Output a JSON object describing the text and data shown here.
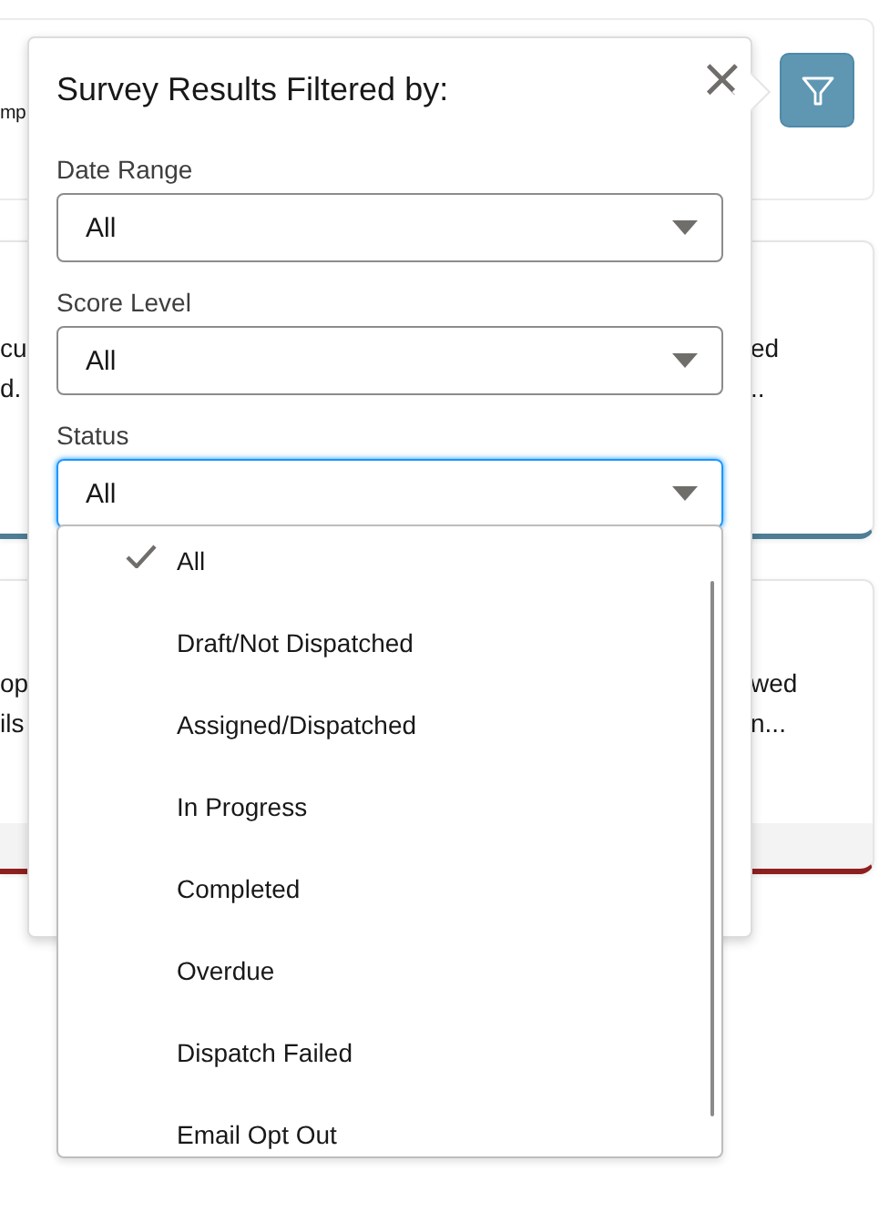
{
  "background": {
    "top_fragment": "mp",
    "cards": [
      {
        "left_lines": [
          "cu",
          "d."
        ],
        "right_lines": [
          "ed",
          ".."
        ]
      },
      {
        "left_lines": [
          "op",
          "ils"
        ],
        "right_lines": [
          "wed",
          "n..."
        ]
      }
    ]
  },
  "popover": {
    "title": "Survey Results Filtered by:",
    "close": "×",
    "filters": [
      {
        "label": "Date Range",
        "value": "All",
        "focused": false
      },
      {
        "label": "Score Level",
        "value": "All",
        "focused": false
      },
      {
        "label": "Status",
        "value": "All",
        "focused": true
      }
    ],
    "dropdown": {
      "options": [
        {
          "label": "All",
          "selected": true
        },
        {
          "label": "Draft/Not Dispatched",
          "selected": false
        },
        {
          "label": "Assigned/Dispatched",
          "selected": false
        },
        {
          "label": "In Progress",
          "selected": false
        },
        {
          "label": "Completed",
          "selected": false
        },
        {
          "label": "Overdue",
          "selected": false
        },
        {
          "label": "Dispatch Failed",
          "selected": false
        },
        {
          "label": "Email Opt Out",
          "selected": false
        }
      ]
    }
  }
}
